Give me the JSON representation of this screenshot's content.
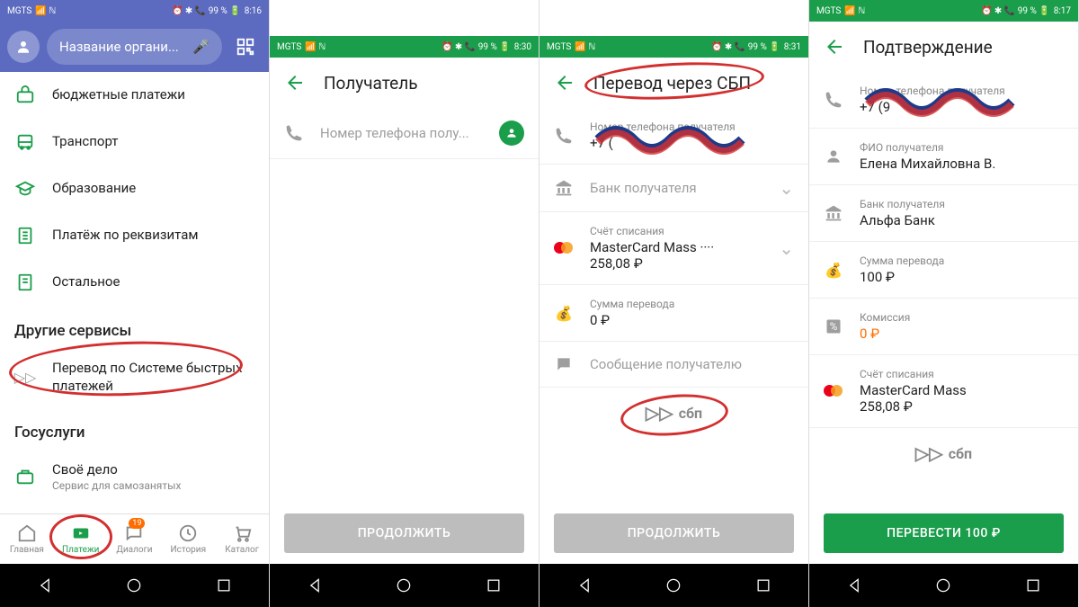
{
  "status": {
    "carrier": "MGTS",
    "indicators": "⏰ ✱ 📞 99 % 🔋",
    "time1": "8:16",
    "time2": "8:30",
    "time3": "8:31",
    "time4": "8:17"
  },
  "screen1": {
    "search_placeholder": "Название органи...",
    "menu": {
      "budget": "бюджетные платежи",
      "transport": "Транспорт",
      "education": "Образование",
      "requisites": "Платёж по реквизитам",
      "other": "Остальное"
    },
    "section_services": "Другие сервисы",
    "sbp_transfer": "Перевод по Системе быстрых платежей",
    "section_gov": "Госуслуги",
    "own_business": "Своё дело",
    "own_business_sub": "Сервис для самозанятых",
    "nav": {
      "home": "Главная",
      "payments": "Платежи",
      "dialogs": "Диалоги",
      "history": "История",
      "catalog": "Каталог",
      "badge": "19"
    }
  },
  "screen2": {
    "title": "Получатель",
    "phone_placeholder": "Номер телефона полу...",
    "continue": "ПРОДОЛЖИТЬ"
  },
  "screen3": {
    "title": "Перевод через СБП",
    "phone_label": "Номер телефона получателя",
    "phone_value": "+7 (",
    "bank_placeholder": "Банк получателя",
    "account_label": "Счёт списания",
    "account_value": "MasterCard Mass ····",
    "account_balance": "258,08 ₽",
    "amount_label": "Сумма перевода",
    "amount_value": "0 ₽",
    "message_placeholder": "Сообщение получателю",
    "sbp": "сбп",
    "continue": "ПРОДОЛЖИТЬ"
  },
  "screen4": {
    "title": "Подтверждение",
    "phone_label": "Номер телефона получателя",
    "phone_value": "+7 (9",
    "name_label": "ФИО получателя",
    "name_value": "Елена Михайловна В.",
    "bank_label": "Банк получателя",
    "bank_value": "Альфа Банк",
    "amount_label": "Сумма перевода",
    "amount_value": "100 ₽",
    "commission_label": "Комиссия",
    "commission_value": "0 ₽",
    "account_label": "Счёт списания",
    "account_value": "MasterCard Mass",
    "account_balance": "258,08 ₽",
    "sbp": "сбп",
    "transfer_btn": "ПЕРЕВЕСТИ 100 ₽"
  }
}
